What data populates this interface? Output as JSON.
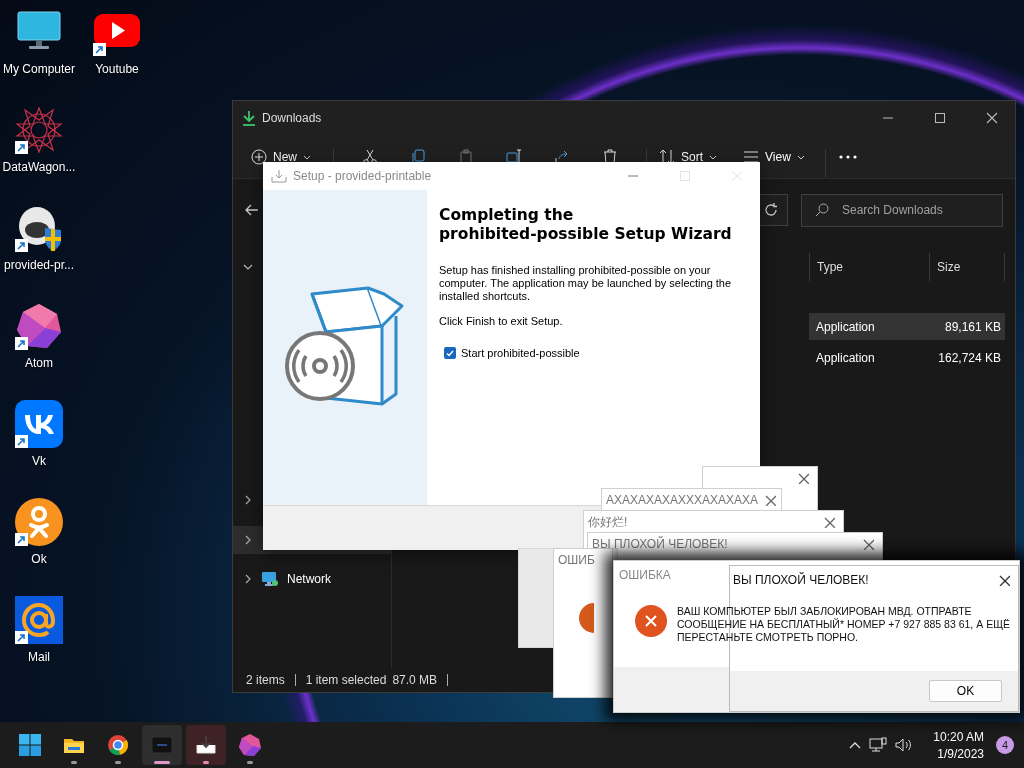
{
  "desktop_icons": [
    {
      "label": "My Computer",
      "shortcut": false
    },
    {
      "label": "Youtube",
      "shortcut": true
    },
    {
      "label": "DataWagon...",
      "shortcut": true
    },
    {
      "label": "provided-pr...",
      "shortcut": true
    },
    {
      "label": "Atom",
      "shortcut": true
    },
    {
      "label": "Vk",
      "shortcut": true
    },
    {
      "label": "Ok",
      "shortcut": true
    },
    {
      "label": "Mail",
      "shortcut": true
    }
  ],
  "explorer": {
    "title": "Downloads",
    "toolbar": [
      {
        "label": "New"
      },
      {
        "label": "Sort"
      },
      {
        "label": "View"
      }
    ],
    "search": {
      "placeholder": "Search Downloads"
    },
    "columns": [
      "Type",
      "Size"
    ],
    "rows": [
      {
        "type": "Application",
        "size": "89,161 KB",
        "selected": true
      },
      {
        "type": "Application",
        "size": "162,724 KB",
        "selected": false
      }
    ],
    "sidebar": [
      {
        "label": "Network"
      }
    ],
    "status_bar": [
      "2 items",
      "1 item selected",
      "87.0 MB"
    ]
  },
  "setup": {
    "title": "Setup - provided-printable",
    "heading": "Completing the\nprohibited-possible Setup Wizard",
    "body": "Setup has finished installing prohibited-possible on your computer. The application may be launched by selecting the installed shortcuts.",
    "hint": "Click Finish to exit Setup.",
    "checkbox": {
      "label": "Start prohibited-possible",
      "checked": true
    }
  },
  "message_windows": [
    {
      "title": "АХАХАХАХАХХХАХАХАХА"
    },
    {
      "title": "你好烂!"
    },
    {
      "title": "ВЫ ПЛОХОЙ ЧЕЛОВЕК!"
    },
    {
      "title": "ОШИБ"
    }
  ],
  "error_dialog": {
    "title": "ОШИБКА",
    "message": "ВАШ КОМПЬЮТЕР БЫЛ ЗАБЛОКИРОВАН МВД. ОТПРАВТЕ СООБЩЕНИЕ НА БЕСПЛАТНЫЙ* НОМЕР +7 927 885 83 61, А ЕЩЁ ПЕРЕСТАНЬТЕ СМОТРЕТЬ ПОРНО.",
    "dialog_title": "ВЫ ПЛОХОЙ ЧЕЛОВЕК!",
    "button": "OK"
  },
  "taskbar": {
    "apps": [
      {
        "running": true,
        "selected": false,
        "attention": false
      },
      {
        "running": true,
        "selected": false,
        "attention": false
      },
      {
        "running": true,
        "selected": true,
        "attention": false
      },
      {
        "running": true,
        "selected": false,
        "attention": true
      },
      {
        "running": true,
        "selected": false,
        "attention": false
      }
    ],
    "time": "10:20 AM",
    "date": "1/9/2023",
    "notification_count": "4"
  }
}
